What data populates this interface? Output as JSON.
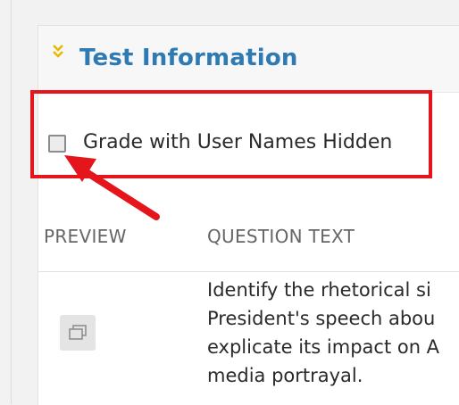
{
  "section": {
    "title": "Test Information"
  },
  "options": {
    "hide_user_names_label": "Grade with User Names Hidden"
  },
  "table": {
    "columns": [
      "PREVIEW",
      "QUESTION TEXT"
    ],
    "rows": [
      {
        "question_lines": [
          "Identify the rhetorical si",
          "President's speech abou",
          "explicate its impact on A",
          "media portrayal."
        ]
      }
    ]
  },
  "colors": {
    "accent": "#2e7bb4",
    "highlight": "#e4161b",
    "chevron": "#e8b800"
  },
  "icons": {
    "collapse": "double-chevron-down-icon",
    "preview": "preview-window-icon"
  }
}
